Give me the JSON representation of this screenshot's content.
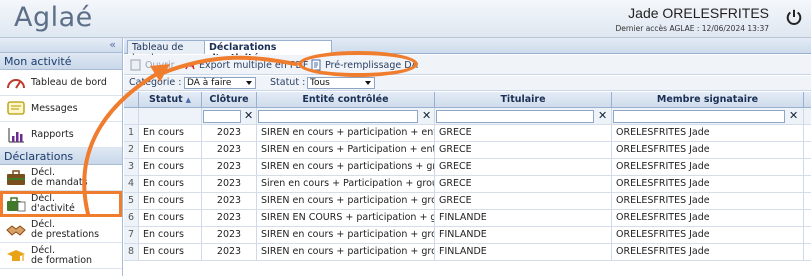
{
  "header": {
    "logo": "Aglaé",
    "user_name": "Jade ORELESFRITES",
    "last_access": "Dernier accès AGLAE : 12/06/2024 13:37"
  },
  "sidebar": {
    "collapse": "«",
    "sections": [
      {
        "title": "Mon activité"
      },
      {
        "title": "Déclarations"
      }
    ],
    "activity_items": [
      {
        "label": "Tableau de bord",
        "icon": "gauge-icon"
      },
      {
        "label": "Messages",
        "icon": "message-icon"
      },
      {
        "label": "Rapports",
        "icon": "chart-icon"
      }
    ],
    "declaration_items": [
      {
        "label1": "Décl.",
        "label2": "de mandats",
        "icon": "briefcase-icon"
      },
      {
        "label1": "Décl.",
        "label2": "d'activité",
        "icon": "briefcase-doc-icon",
        "selected": true
      },
      {
        "label1": "Décl.",
        "label2": "de prestations",
        "icon": "handshake-icon"
      },
      {
        "label1": "Décl.",
        "label2": "de formation",
        "icon": "graduation-icon"
      }
    ]
  },
  "tabs": [
    {
      "label": "Tableau de bord",
      "active": false
    },
    {
      "label": "Déclarations d'activité",
      "active": true,
      "close": "×"
    }
  ],
  "toolbar": {
    "open": "Ouvrir",
    "export": "Export multiple en PDF",
    "prefill": "Pré-remplissage DA"
  },
  "filters": {
    "category_label": "Catégorie :",
    "category_value": "DA à faire",
    "status_label": "Statut :",
    "status_value": "Tous"
  },
  "grid": {
    "columns": [
      "Statut",
      "Clôture",
      "Entité contrôlée",
      "Titulaire",
      "Membre signataire"
    ],
    "rows": [
      [
        "1",
        "En cours",
        "2023",
        "SIREN en cours + participation + entité r",
        "GRECE",
        "ORELESFRITES Jade"
      ],
      [
        "2",
        "En cours",
        "2023",
        "SIREN en cours + Participation + entitée",
        "GRECE",
        "ORELESFRITES Jade"
      ],
      [
        "3",
        "En cours",
        "2023",
        "SIREN en cours + participations + group",
        "GRECE",
        "ORELESFRITES Jade"
      ],
      [
        "4",
        "En cours",
        "2023",
        "Siren en cours + Participation + groupe d",
        "GRECE",
        "ORELESFRITES Jade"
      ],
      [
        "5",
        "En cours",
        "2023",
        "SIREN en cours + participation + groupe",
        "GRECE",
        "ORELESFRITES Jade"
      ],
      [
        "6",
        "En cours",
        "2023",
        "SIREN EN COURS + participation + group",
        "FINLANDE",
        "ORELESFRITES Jade"
      ],
      [
        "7",
        "En cours",
        "2023",
        "SIREN en cours + participation + groupe",
        "FINLANDE",
        "ORELESFRITES Jade"
      ],
      [
        "8",
        "En cours",
        "2023",
        "SIREN en cours + participation + groupe",
        "FINLANDE",
        "ORELESFRITES Jade"
      ]
    ]
  }
}
